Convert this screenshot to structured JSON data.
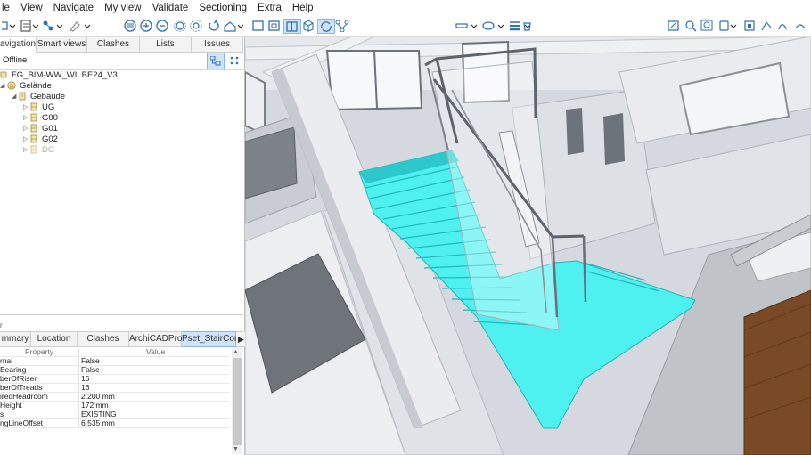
{
  "menubar": {
    "items": [
      "le",
      "View",
      "Navigate",
      "My view",
      "Validate",
      "Sectioning",
      "Extra",
      "Help"
    ]
  },
  "navigation": {
    "tabs": [
      "avigation",
      "Smart views",
      "Clashes",
      "Lists",
      "Issues"
    ],
    "mode": "Offline"
  },
  "tree": {
    "model": "FG_BIM-WW_WILBE24_V3",
    "site": "Gelände",
    "building": "Gebäude",
    "storeys": [
      "UG",
      "G00",
      "G01",
      "G02",
      "DG"
    ]
  },
  "properties": {
    "tabs": [
      "mmary",
      "Location",
      "Clashes",
      "ArchiCADPro...",
      "Pset_StairCom..."
    ],
    "header_property": "Property",
    "header_value": "Value",
    "rows": [
      {
        "name": "rnal",
        "value": "False"
      },
      {
        "name": "Bearing",
        "value": "False"
      },
      {
        "name": "berOfRiser",
        "value": "16"
      },
      {
        "name": "berOfTreads",
        "value": "16"
      },
      {
        "name": "iredHeadroom",
        "value": "2.200 mm"
      },
      {
        "name": "Height",
        "value": "172 mm"
      },
      {
        "name": "s",
        "value": "EXISTING"
      },
      {
        "name": "ngLineOffset",
        "value": "6.535 mm"
      }
    ]
  },
  "colors": {
    "stair": "#4ff0f0",
    "selected_tab": "#cfe3fb",
    "accent": "#2f6fb5"
  }
}
